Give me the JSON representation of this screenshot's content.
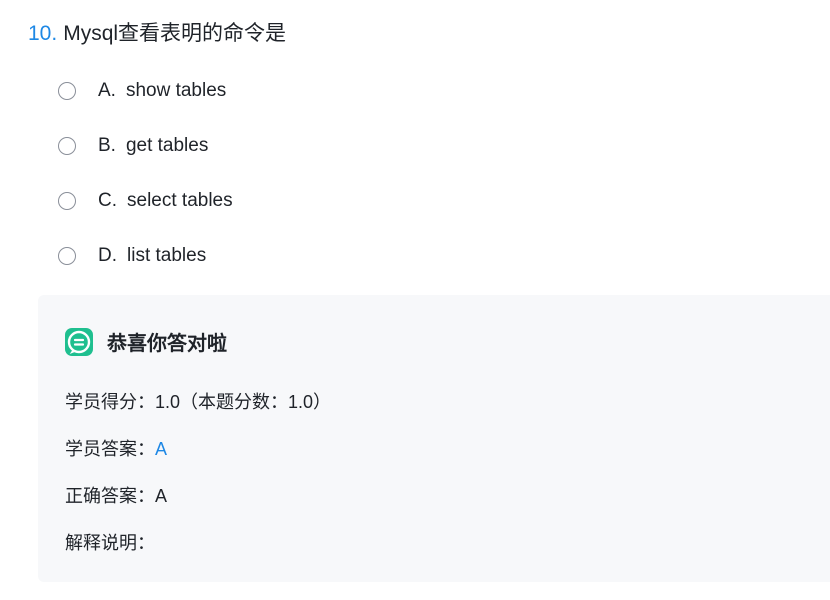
{
  "question": {
    "number": "10.",
    "text": "Mysql查看表明的命令是"
  },
  "options": [
    {
      "letter": "A.",
      "text": "show tables"
    },
    {
      "letter": "B.",
      "text": "get tables"
    },
    {
      "letter": "C.",
      "text": "select tables"
    },
    {
      "letter": "D.",
      "text": "list tables"
    }
  ],
  "result": {
    "title": "恭喜你答对啦",
    "score_label": "学员得分：",
    "score_value": "1.0（本题分数：1.0）",
    "student_answer_label": "学员答案：",
    "student_answer_value": "A",
    "correct_answer_label": "正确答案：",
    "correct_answer_value": "A",
    "explanation_label": "解释说明：",
    "explanation_value": ""
  },
  "colors": {
    "accent": "#1e88e5",
    "success": "#1fbf8f",
    "panel_bg": "#f7f8fa"
  }
}
